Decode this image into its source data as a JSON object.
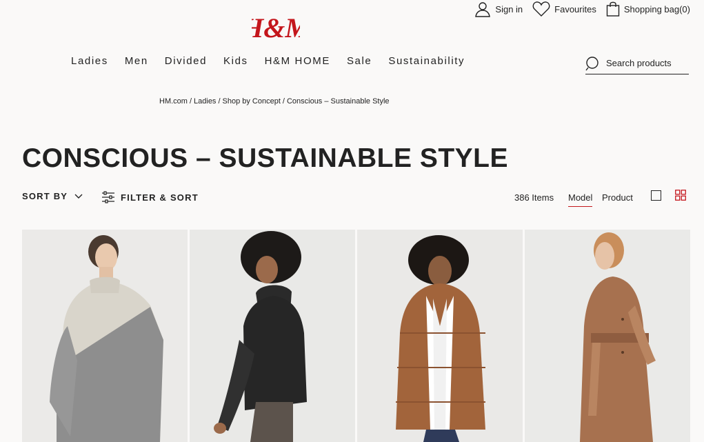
{
  "header": {
    "logo_text": "H&M",
    "sign_in": "Sign in",
    "favourites": "Favourites",
    "shopping_bag": "Shopping bag(0)"
  },
  "nav": {
    "items": [
      {
        "label": "Ladies"
      },
      {
        "label": "Men"
      },
      {
        "label": "Divided"
      },
      {
        "label": "Kids"
      },
      {
        "label": "H&M HOME"
      },
      {
        "label": "Sale"
      },
      {
        "label": "Sustainability"
      }
    ]
  },
  "search": {
    "placeholder": "Search products",
    "icon": "search-icon"
  },
  "breadcrumb": {
    "items": [
      {
        "label": "HM.com"
      },
      {
        "label": "Ladies"
      },
      {
        "label": "Shop by Concept"
      },
      {
        "label": "Conscious – Sustainable Style"
      }
    ],
    "separator": "/"
  },
  "page": {
    "title": "CONSCIOUS – SUSTAINABLE STYLE"
  },
  "toolbar": {
    "sort_by": "SORT BY",
    "filter_sort": "FILTER & SORT",
    "item_count": "386 Items",
    "view_model": "Model",
    "view_product": "Product",
    "active_view": "Model"
  },
  "products": [
    {
      "name": "colour-block-sweater",
      "bg": "#ebeae8",
      "main": "#d9d5cb",
      "accent": "#8e8e8e"
    },
    {
      "name": "black-turtleneck",
      "bg": "#e9e9e7",
      "main": "#262626",
      "accent": "#3b3b3b"
    },
    {
      "name": "brown-puffer-jacket",
      "bg": "#eae9e7",
      "main": "#a2643b",
      "accent": "#ffffff"
    },
    {
      "name": "camel-wool-coat",
      "bg": "#eaeae8",
      "main": "#a7714f",
      "accent": "#b98561"
    }
  ],
  "colors": {
    "brand_red": "#c4161c",
    "text": "#222222",
    "background": "#faf9f8"
  }
}
